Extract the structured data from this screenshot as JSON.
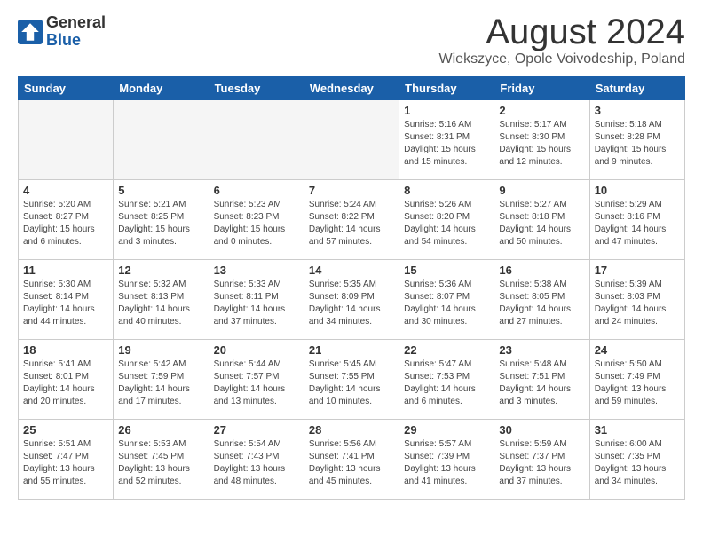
{
  "header": {
    "logo_general": "General",
    "logo_blue": "Blue",
    "month_title": "August 2024",
    "location": "Wiekszyce, Opole Voivodeship, Poland"
  },
  "weekdays": [
    "Sunday",
    "Monday",
    "Tuesday",
    "Wednesday",
    "Thursday",
    "Friday",
    "Saturday"
  ],
  "weeks": [
    [
      {
        "day": "",
        "content": ""
      },
      {
        "day": "",
        "content": ""
      },
      {
        "day": "",
        "content": ""
      },
      {
        "day": "",
        "content": ""
      },
      {
        "day": "1",
        "content": "Sunrise: 5:16 AM\nSunset: 8:31 PM\nDaylight: 15 hours\nand 15 minutes."
      },
      {
        "day": "2",
        "content": "Sunrise: 5:17 AM\nSunset: 8:30 PM\nDaylight: 15 hours\nand 12 minutes."
      },
      {
        "day": "3",
        "content": "Sunrise: 5:18 AM\nSunset: 8:28 PM\nDaylight: 15 hours\nand 9 minutes."
      }
    ],
    [
      {
        "day": "4",
        "content": "Sunrise: 5:20 AM\nSunset: 8:27 PM\nDaylight: 15 hours\nand 6 minutes."
      },
      {
        "day": "5",
        "content": "Sunrise: 5:21 AM\nSunset: 8:25 PM\nDaylight: 15 hours\nand 3 minutes."
      },
      {
        "day": "6",
        "content": "Sunrise: 5:23 AM\nSunset: 8:23 PM\nDaylight: 15 hours\nand 0 minutes."
      },
      {
        "day": "7",
        "content": "Sunrise: 5:24 AM\nSunset: 8:22 PM\nDaylight: 14 hours\nand 57 minutes."
      },
      {
        "day": "8",
        "content": "Sunrise: 5:26 AM\nSunset: 8:20 PM\nDaylight: 14 hours\nand 54 minutes."
      },
      {
        "day": "9",
        "content": "Sunrise: 5:27 AM\nSunset: 8:18 PM\nDaylight: 14 hours\nand 50 minutes."
      },
      {
        "day": "10",
        "content": "Sunrise: 5:29 AM\nSunset: 8:16 PM\nDaylight: 14 hours\nand 47 minutes."
      }
    ],
    [
      {
        "day": "11",
        "content": "Sunrise: 5:30 AM\nSunset: 8:14 PM\nDaylight: 14 hours\nand 44 minutes."
      },
      {
        "day": "12",
        "content": "Sunrise: 5:32 AM\nSunset: 8:13 PM\nDaylight: 14 hours\nand 40 minutes."
      },
      {
        "day": "13",
        "content": "Sunrise: 5:33 AM\nSunset: 8:11 PM\nDaylight: 14 hours\nand 37 minutes."
      },
      {
        "day": "14",
        "content": "Sunrise: 5:35 AM\nSunset: 8:09 PM\nDaylight: 14 hours\nand 34 minutes."
      },
      {
        "day": "15",
        "content": "Sunrise: 5:36 AM\nSunset: 8:07 PM\nDaylight: 14 hours\nand 30 minutes."
      },
      {
        "day": "16",
        "content": "Sunrise: 5:38 AM\nSunset: 8:05 PM\nDaylight: 14 hours\nand 27 minutes."
      },
      {
        "day": "17",
        "content": "Sunrise: 5:39 AM\nSunset: 8:03 PM\nDaylight: 14 hours\nand 24 minutes."
      }
    ],
    [
      {
        "day": "18",
        "content": "Sunrise: 5:41 AM\nSunset: 8:01 PM\nDaylight: 14 hours\nand 20 minutes."
      },
      {
        "day": "19",
        "content": "Sunrise: 5:42 AM\nSunset: 7:59 PM\nDaylight: 14 hours\nand 17 minutes."
      },
      {
        "day": "20",
        "content": "Sunrise: 5:44 AM\nSunset: 7:57 PM\nDaylight: 14 hours\nand 13 minutes."
      },
      {
        "day": "21",
        "content": "Sunrise: 5:45 AM\nSunset: 7:55 PM\nDaylight: 14 hours\nand 10 minutes."
      },
      {
        "day": "22",
        "content": "Sunrise: 5:47 AM\nSunset: 7:53 PM\nDaylight: 14 hours\nand 6 minutes."
      },
      {
        "day": "23",
        "content": "Sunrise: 5:48 AM\nSunset: 7:51 PM\nDaylight: 14 hours\nand 3 minutes."
      },
      {
        "day": "24",
        "content": "Sunrise: 5:50 AM\nSunset: 7:49 PM\nDaylight: 13 hours\nand 59 minutes."
      }
    ],
    [
      {
        "day": "25",
        "content": "Sunrise: 5:51 AM\nSunset: 7:47 PM\nDaylight: 13 hours\nand 55 minutes."
      },
      {
        "day": "26",
        "content": "Sunrise: 5:53 AM\nSunset: 7:45 PM\nDaylight: 13 hours\nand 52 minutes."
      },
      {
        "day": "27",
        "content": "Sunrise: 5:54 AM\nSunset: 7:43 PM\nDaylight: 13 hours\nand 48 minutes."
      },
      {
        "day": "28",
        "content": "Sunrise: 5:56 AM\nSunset: 7:41 PM\nDaylight: 13 hours\nand 45 minutes."
      },
      {
        "day": "29",
        "content": "Sunrise: 5:57 AM\nSunset: 7:39 PM\nDaylight: 13 hours\nand 41 minutes."
      },
      {
        "day": "30",
        "content": "Sunrise: 5:59 AM\nSunset: 7:37 PM\nDaylight: 13 hours\nand 37 minutes."
      },
      {
        "day": "31",
        "content": "Sunrise: 6:00 AM\nSunset: 7:35 PM\nDaylight: 13 hours\nand 34 minutes."
      }
    ]
  ]
}
